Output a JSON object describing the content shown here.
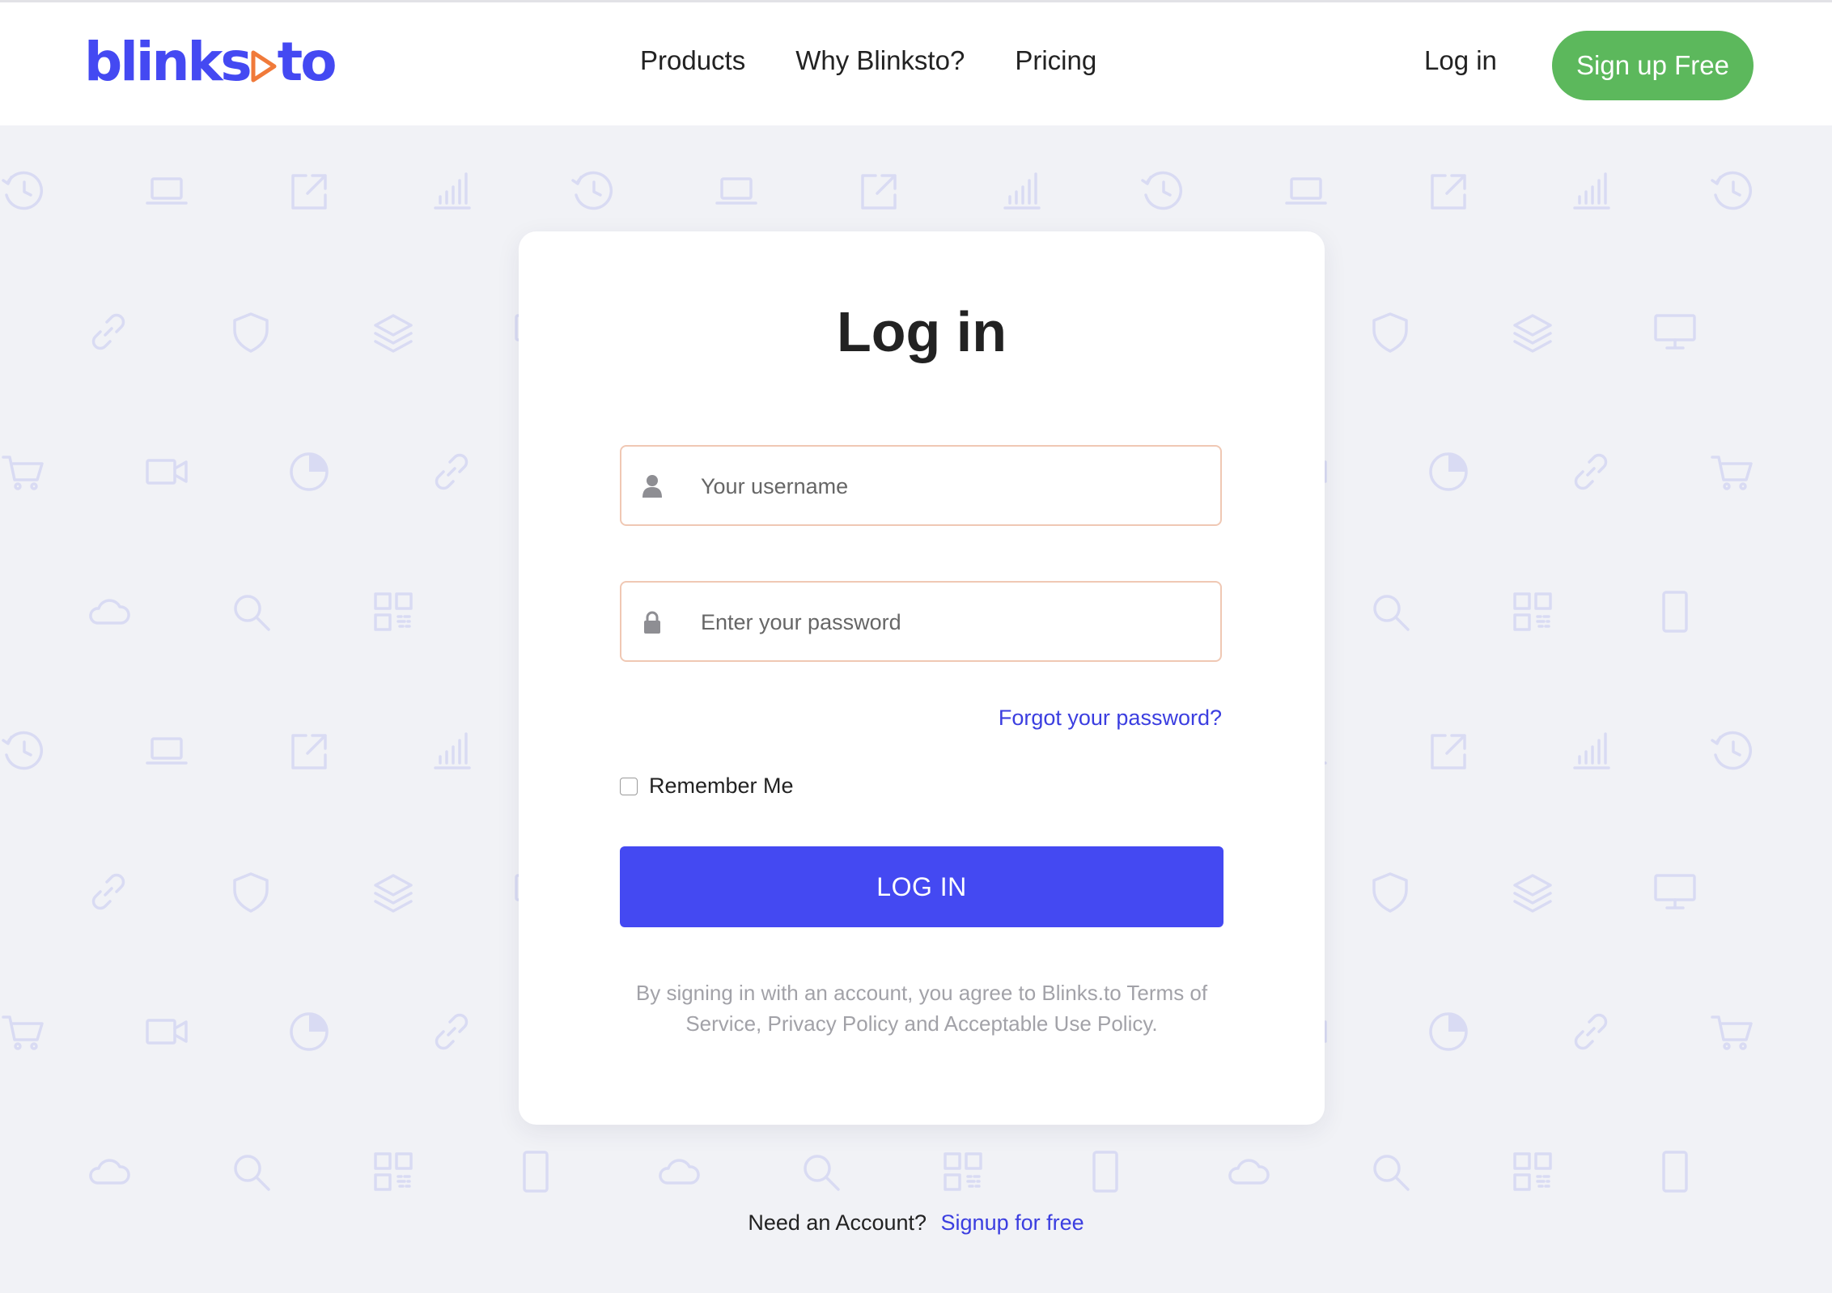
{
  "brand": {
    "logo_text_left": "blinks",
    "logo_text_right": "to",
    "logo_play_color": "#f07a3a",
    "primary_color": "#4449f2",
    "signup_color": "#5cb85c"
  },
  "header": {
    "nav": [
      {
        "label": "Products"
      },
      {
        "label": "Why Blinksto?"
      },
      {
        "label": "Pricing"
      }
    ],
    "login_label": "Log in",
    "signup_label": "Sign up Free"
  },
  "background": {
    "icon_rows": [
      [
        "history-icon",
        "laptop-icon",
        "external-link-icon",
        "bar-chart-icon"
      ],
      [
        "link-icon",
        "shield-icon",
        "layers-icon",
        "monitor-icon"
      ],
      [
        "cart-icon",
        "video-icon",
        "pie-chart-icon",
        "link-icon"
      ],
      [
        "cloud-icon",
        "search-icon",
        "qr-code-icon",
        "tablet-icon"
      ]
    ]
  },
  "login_card": {
    "title": "Log in",
    "username_placeholder": "Your username",
    "password_placeholder": "Enter your password",
    "forgot_label": "Forgot your password?",
    "remember_label": "Remember Me",
    "remember_checked": false,
    "submit_label": "LOG IN",
    "terms": "By signing in with an account, you agree to Blinks.to Terms of Service, Privacy Policy and Acceptable Use Policy."
  },
  "footer": {
    "prompt": "Need an Account?",
    "signup_link": "Signup for free"
  }
}
